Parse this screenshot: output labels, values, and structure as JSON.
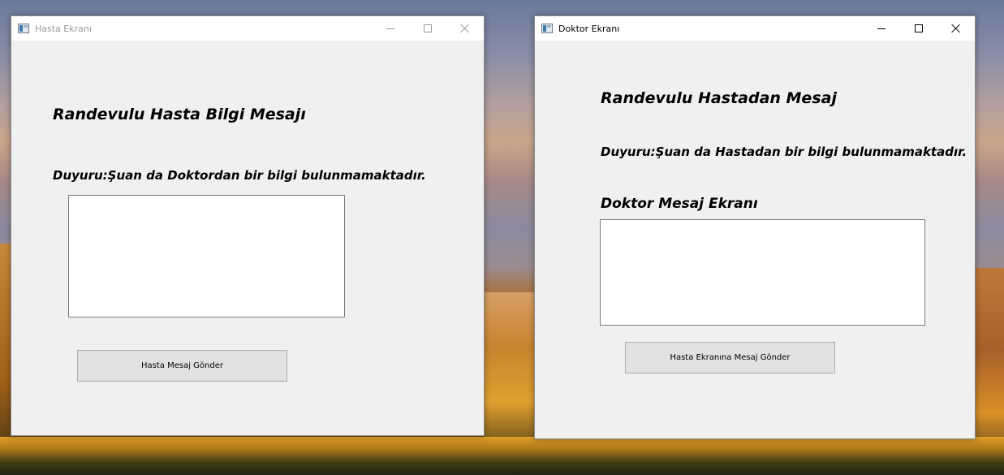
{
  "patient_window": {
    "title": "Hasta Ekranı",
    "heading": "Randevulu Hasta Bilgi Mesajı",
    "notice": "Duyuru:Şuan da Doktordan bir bilgi bulunmamaktadır.",
    "message_value": "",
    "send_button": "Hasta Mesaj Gönder"
  },
  "doctor_window": {
    "title": "Doktor Ekranı",
    "heading": "Randevulu Hastadan Mesaj",
    "notice": "Duyuru:Şuan da Hastadan bir bilgi bulunmamaktadır.",
    "message_label": "Doktor Mesaj Ekranı",
    "message_value": "",
    "send_button": "Hasta Ekranına Mesaj Gönder"
  }
}
